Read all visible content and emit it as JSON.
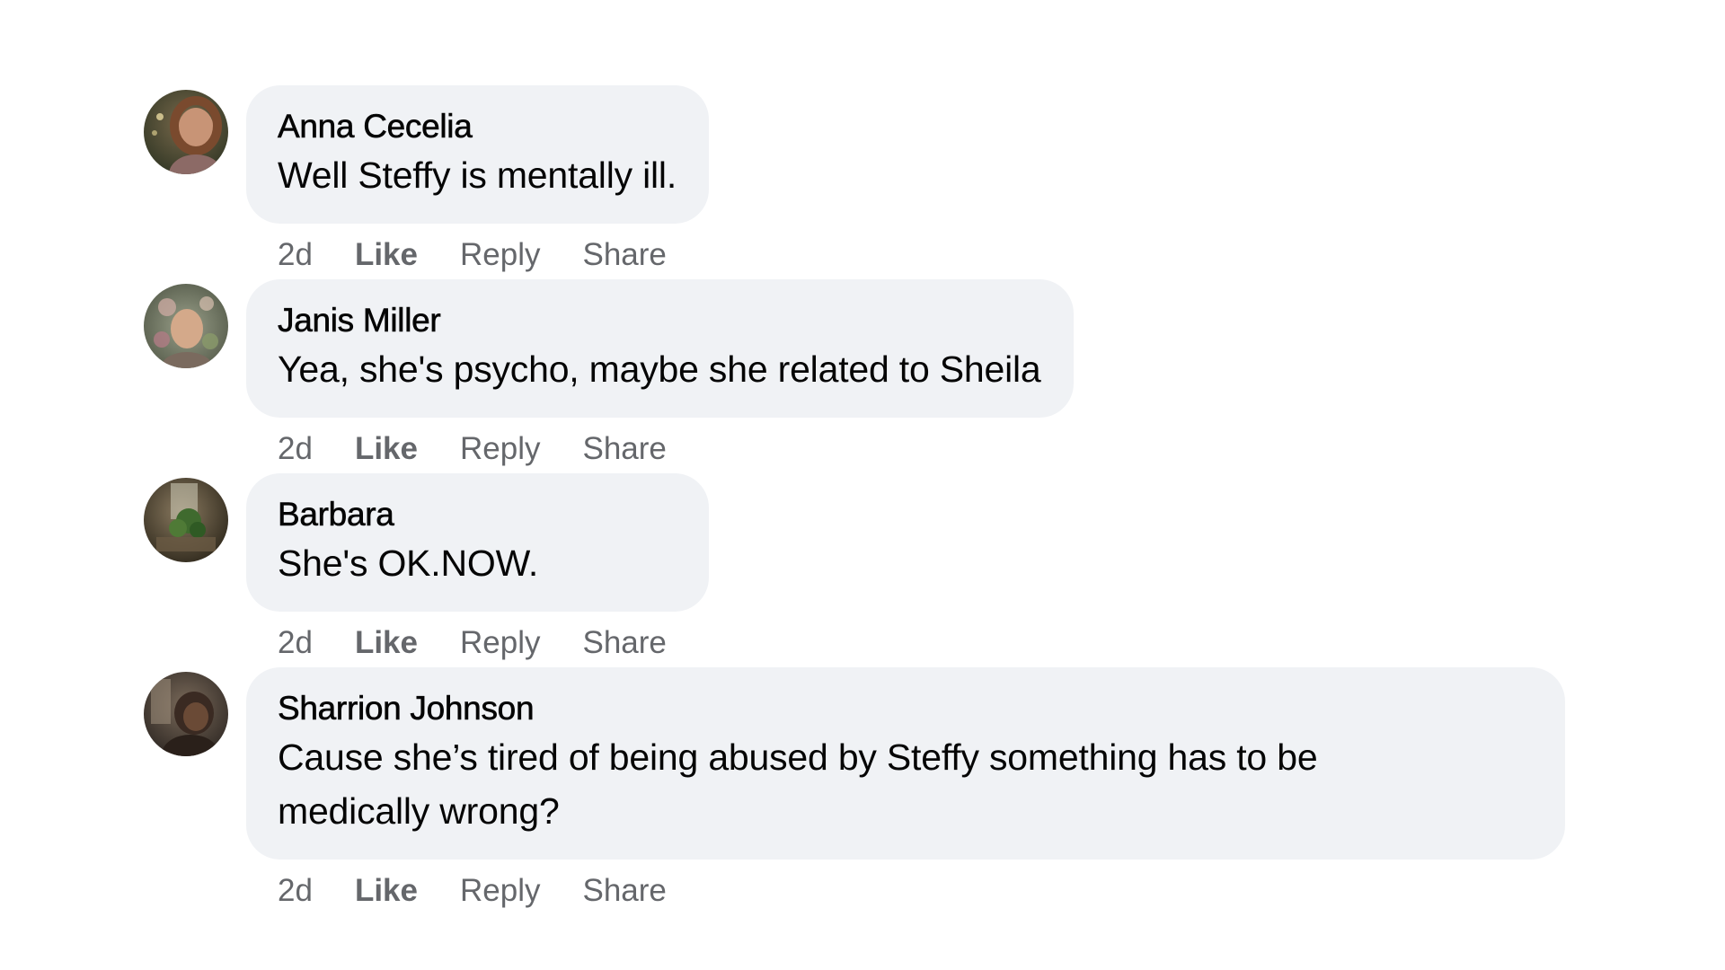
{
  "comments": [
    {
      "author": "Anna Cecelia",
      "text": "Well Steffy is mentally ill.",
      "time": "2d",
      "actions": {
        "like": "Like",
        "reply": "Reply",
        "share": "Share"
      }
    },
    {
      "author": "Janis Miller",
      "text": "Yea, she's psycho, maybe she related to Sheila",
      "time": "2d",
      "actions": {
        "like": "Like",
        "reply": "Reply",
        "share": "Share"
      }
    },
    {
      "author": "Barbara",
      "text": "She's OK.NOW.",
      "time": "2d",
      "actions": {
        "like": "Like",
        "reply": "Reply",
        "share": "Share"
      }
    },
    {
      "author": "Sharrion Johnson",
      "text": "Cause she’s tired of being abused by Steffy something has to be medically wrong?",
      "time": "2d",
      "actions": {
        "like": "Like",
        "reply": "Reply",
        "share": "Share"
      }
    }
  ],
  "colors": {
    "bubble": "#f0f2f5",
    "text": "#050505",
    "meta": "#65676b"
  }
}
